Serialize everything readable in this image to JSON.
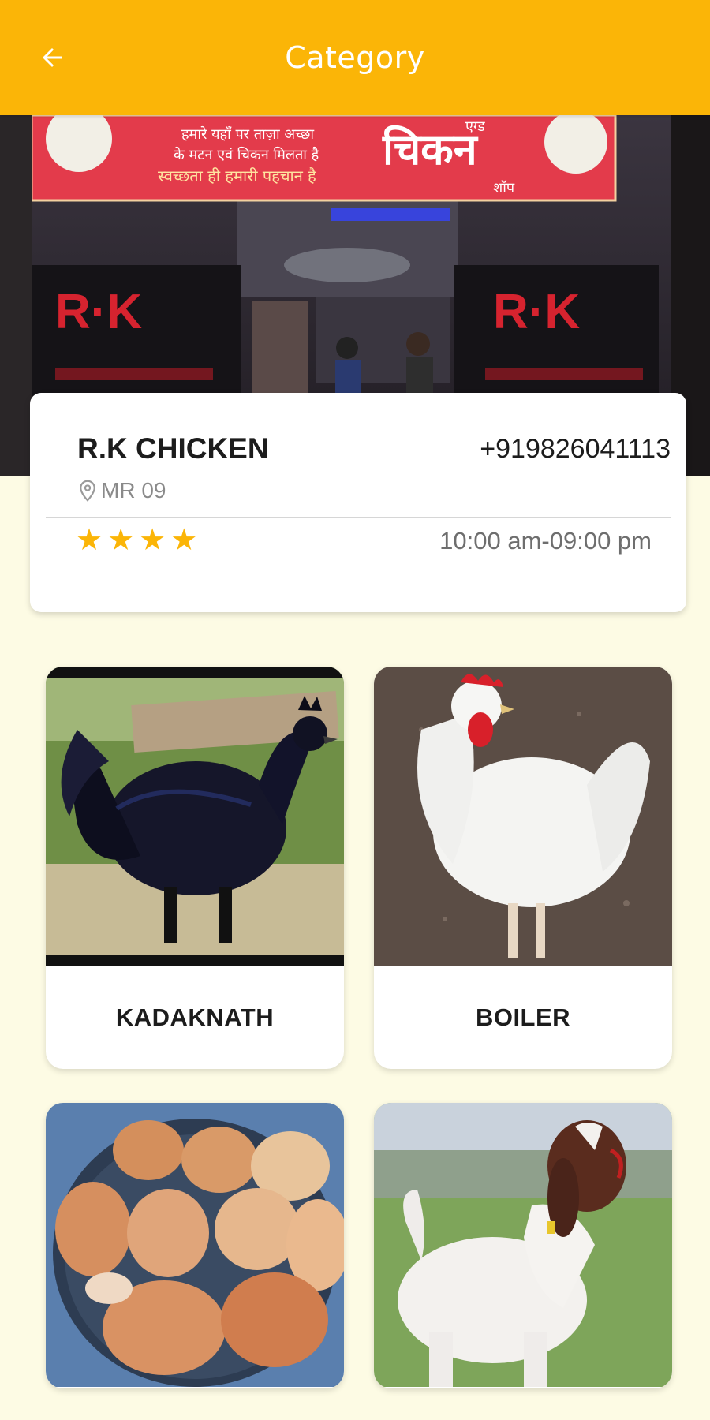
{
  "app_bar": {
    "title": "Category",
    "back_icon": "arrow-left-icon"
  },
  "banner": {
    "board_main": "चिकन",
    "board_small": "एग्ड",
    "board_shop": "शॉप",
    "board_line1": "हमारे यहाँ पर ताज़ा अच्छा",
    "board_line2": "के मटन एवं चिकन मिलता है",
    "board_line3": "स्वच्छता ही हमारी पहचान है",
    "sign_text": "R·K"
  },
  "shop": {
    "name": "R.K CHICKEN",
    "phone": "+919826041113",
    "location": "MR 09",
    "rating": 4,
    "hours": "10:00 am-09:00 pm"
  },
  "categories": [
    {
      "label": "KADAKNATH",
      "image": "black-rooster"
    },
    {
      "label": "BOILER",
      "image": "white-hen"
    },
    {
      "label": "",
      "image": "eggs-bowl"
    },
    {
      "label": "",
      "image": "goat"
    }
  ],
  "colors": {
    "accent": "#fbb507",
    "background": "#fdfbe4"
  }
}
